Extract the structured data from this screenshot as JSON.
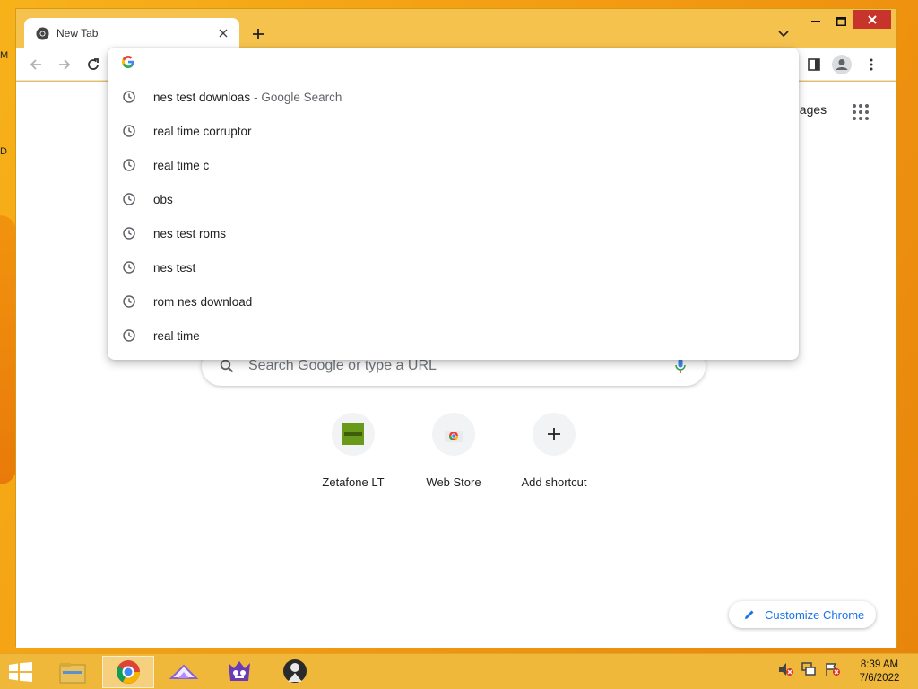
{
  "browser": {
    "tab_title": "New Tab",
    "accent_titlebar": "#f6c24e",
    "close_color": "#c7342b"
  },
  "omnibox": {
    "value": "",
    "suggestions": [
      {
        "text": "nes test downloas",
        "suffix": "- Google Search"
      },
      {
        "text": "real time corruptor",
        "suffix": ""
      },
      {
        "text": "real time c",
        "suffix": ""
      },
      {
        "text": "obs",
        "suffix": ""
      },
      {
        "text": "nes test roms",
        "suffix": ""
      },
      {
        "text": "nes test",
        "suffix": ""
      },
      {
        "text": "rom nes download",
        "suffix": ""
      },
      {
        "text": "real time",
        "suffix": ""
      }
    ]
  },
  "ntp": {
    "images_link": "nages",
    "search_placeholder": "Search Google or type a URL",
    "shortcuts": [
      {
        "label": "Zetafone LT",
        "icon": "zetafone-icon"
      },
      {
        "label": "Web Store",
        "icon": "webstore-icon"
      },
      {
        "label": "Add shortcut",
        "icon": "plus-icon"
      }
    ],
    "customize_label": "Customize Chrome"
  },
  "desktop": {
    "edge_letters": [
      "M",
      "D"
    ]
  },
  "taskbar": {
    "apps": [
      "file-explorer-icon",
      "chrome-icon",
      "app-triangle-icon",
      "app-creature-icon",
      "app-figure-icon"
    ],
    "time": "8:39 AM",
    "date": "7/6/2022"
  }
}
